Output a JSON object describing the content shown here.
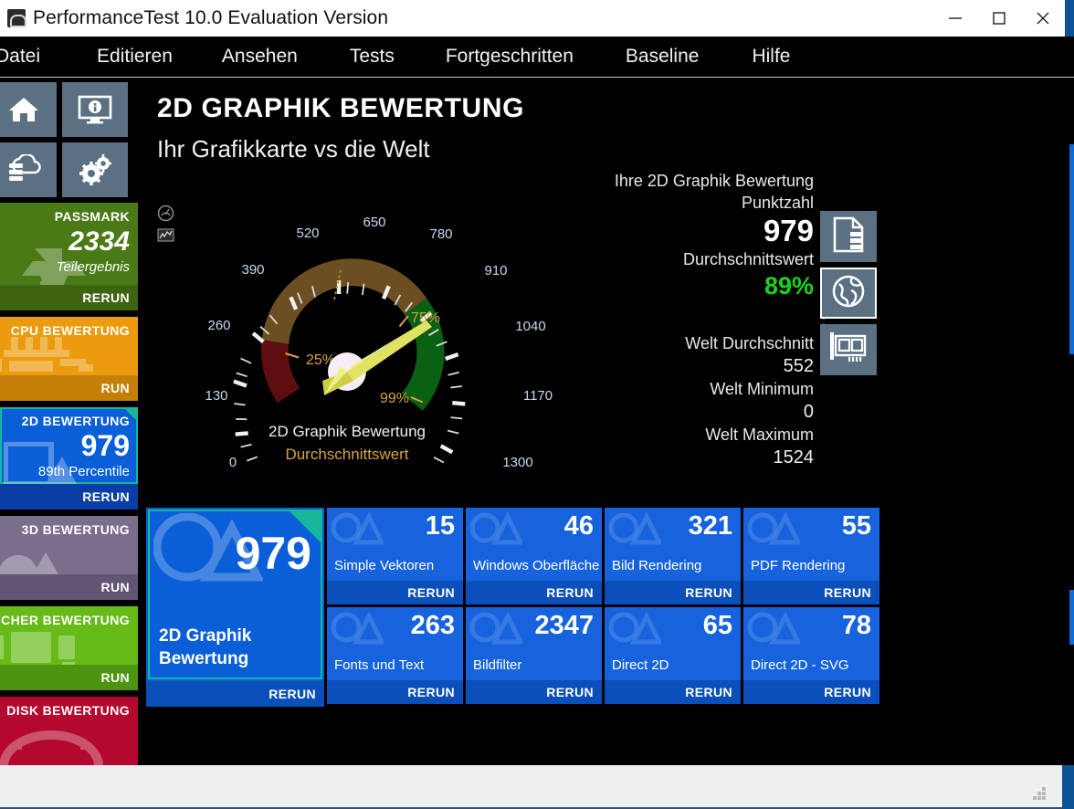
{
  "window": {
    "title": "PerformanceTest 10.0 Evaluation Version",
    "app_icon": "passmark-logo-icon",
    "minimize_label": "—",
    "maximize_label": "□",
    "close_label": "✕"
  },
  "menubar": {
    "items": [
      {
        "label": "Datei"
      },
      {
        "label": "Editieren"
      },
      {
        "label": "Ansehen"
      },
      {
        "label": "Tests"
      },
      {
        "label": "Fortgeschritten"
      },
      {
        "label": "Baseline"
      },
      {
        "label": "Hilfe"
      }
    ]
  },
  "sidebar": {
    "quick_icons": [
      {
        "name": "home-icon"
      },
      {
        "name": "system-info-icon"
      },
      {
        "name": "cloud-database-icon"
      },
      {
        "name": "settings-gears-icon"
      }
    ],
    "tiles": [
      {
        "name": "passmark-rating",
        "head": "PASSMARK",
        "value": "2334",
        "sub": "Teilergebnis",
        "action": "RERUN",
        "color": "#4a7a16",
        "foot_color": "#3d6411",
        "ghost": "trophy-icon"
      },
      {
        "name": "cpu-rating",
        "head": "CPU BEWERTUNG",
        "value": "",
        "sub": "",
        "action": "RUN",
        "color": "#eb9b0d",
        "foot_color": "#c47f08",
        "ghost": "cpu-icon"
      },
      {
        "name": "2d-rating",
        "head": "2D BEWERTUNG",
        "value": "979",
        "sub": "89th Percentile",
        "action": "RERUN",
        "color": "#0a5fd8",
        "foot_color": "#0a3ea6",
        "ghost": "2d-graphics-icon",
        "selected": true
      },
      {
        "name": "3d-rating",
        "head": "3D BEWERTUNG",
        "value": "",
        "sub": "",
        "action": "RUN",
        "color": "#7a6e8c",
        "foot_color": "#615571",
        "ghost": "3d-graphics-icon"
      },
      {
        "name": "memory-rating",
        "head": "PEICHER BEWERTUNG",
        "value": "",
        "sub": "",
        "action": "RUN",
        "color": "#67bb18",
        "foot_color": "#4e9410",
        "ghost": "memory-icon"
      },
      {
        "name": "disk-rating",
        "head": "DISK BEWERTUNG",
        "value": "",
        "sub": "",
        "action": "",
        "color": "#b5082e",
        "foot_color": "#8d0523",
        "ghost": "disk-icon"
      }
    ]
  },
  "main": {
    "title": "2D GRAPHIK BEWERTUNG",
    "subtitle": "Ihr Grafikkarte vs die Welt",
    "view_toggles": [
      {
        "name": "gauge-view-toggle"
      },
      {
        "name": "chart-view-toggle"
      }
    ],
    "stats": {
      "score_label": "Ihre 2D Graphik Bewertung Punktzahl",
      "score_value": "979",
      "percentile_label": "Durchschnittswert",
      "percentile_value": "89%",
      "percentile_color": "#19d419",
      "world_avg_label": "Welt Durchschnitt",
      "world_avg_value": "552",
      "world_min_label": "Welt Minimum",
      "world_min_value": "0",
      "world_max_label": "Welt Maximum",
      "world_max_value": "1524"
    },
    "icon_buttons": [
      {
        "name": "details-document-icon",
        "selected": false
      },
      {
        "name": "globe-icon",
        "selected": true
      },
      {
        "name": "graphics-card-icon",
        "selected": false
      }
    ]
  },
  "chart_data": {
    "type": "gauge",
    "title": "2D Graphik Bewertung",
    "subtitle": "Durchschnittswert",
    "value": 979,
    "min": 0,
    "max": 1300,
    "tick_labels": [
      "0",
      "130",
      "260",
      "390",
      "520",
      "650",
      "780",
      "910",
      "1040",
      "1170",
      "1300"
    ],
    "tick_values": [
      0,
      130,
      260,
      390,
      520,
      650,
      780,
      910,
      1040,
      1170,
      1300
    ],
    "markers": [
      {
        "label": "25%",
        "value": 310,
        "color": "#d9a441"
      },
      {
        "label": "75%",
        "value": 840,
        "color": "#d9a441"
      },
      {
        "label": "99%",
        "value": 1190,
        "color": "#d9a441"
      }
    ],
    "bands": [
      {
        "from": 120,
        "to": 310,
        "color": "#5e0e0e",
        "name": "low"
      },
      {
        "from": 310,
        "to": 840,
        "color": "#6b4f23",
        "name": "mid"
      },
      {
        "from": 840,
        "to": 1245,
        "color": "#0a6013",
        "name": "high"
      }
    ],
    "needle_color": "#d8d84e",
    "axis_label_color": "#c8d8f0",
    "background": "#000000"
  },
  "results": {
    "summary_tile": {
      "name": "2d-graphics-summary",
      "value": "979",
      "label": "2D Graphik\nBewertung",
      "label_line1": "2D Graphik",
      "label_line2": "Bewertung",
      "action": "RERUN"
    },
    "tiles": [
      {
        "name": "simple-vectors",
        "value": "15",
        "label": "Simple Vektoren",
        "action": "RERUN"
      },
      {
        "name": "windows-interface",
        "value": "46",
        "label": "Windows Oberfläche",
        "action": "RERUN"
      },
      {
        "name": "image-rendering",
        "value": "321",
        "label": "Bild Rendering",
        "action": "RERUN"
      },
      {
        "name": "pdf-rendering",
        "value": "55",
        "label": "PDF Rendering",
        "action": "RERUN"
      },
      {
        "name": "fonts-and-text",
        "value": "263",
        "label": "Fonts und Text",
        "action": "RERUN"
      },
      {
        "name": "image-filters",
        "value": "2347",
        "label": "Bildfilter",
        "action": "RERUN"
      },
      {
        "name": "direct-2d",
        "value": "65",
        "label": "Direct 2D",
        "action": "RERUN"
      },
      {
        "name": "direct-2d-svg",
        "value": "78",
        "label": "Direct 2D - SVG",
        "action": "RERUN"
      }
    ]
  }
}
